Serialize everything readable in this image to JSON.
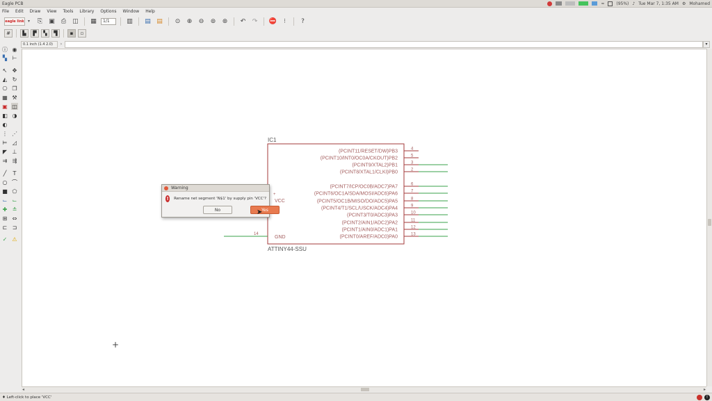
{
  "window": {
    "title": "Eagle PCB"
  },
  "system_tray": {
    "battery": "(95%)",
    "clock": "Tue Mar 7, 1:35 AM",
    "user": "Mohamed"
  },
  "menu": [
    "File",
    "Edit",
    "Draw",
    "View",
    "Tools",
    "Library",
    "Options",
    "Window",
    "Help"
  ],
  "toolbar": {
    "logo_text": "eagle link",
    "sheet_value": "1/1"
  },
  "command_bar": {
    "grid_label": "0.1 inch (1.4 2.0)",
    "command_value": ""
  },
  "schematic": {
    "part_name": "IC1",
    "part_value": "ATTINY44-SSU",
    "net_color": "#39a049",
    "part_color": "#a33a3a",
    "text_color": "#a35c5c",
    "power_pins": [
      {
        "label": "VCC",
        "number": "1",
        "side": "left",
        "connected": false
      },
      {
        "label": "GND",
        "number": "14",
        "side": "left",
        "connected": true
      }
    ],
    "signal_pins": [
      {
        "label": "(PCINT11/RESET/DW)PB3",
        "number": "4",
        "connected": false
      },
      {
        "label": "(PCINT10/INT0/OC0A/CKOUT)PB2",
        "number": "5",
        "connected": false
      },
      {
        "label": "(PCINT9/XTAL2)PB1",
        "number": "3",
        "connected": true
      },
      {
        "label": "(PCINT8/XTAL1/CLKI)PB0",
        "number": "2",
        "connected": true
      },
      {
        "label": "(PCINT7/ICP/OC0B/ADC7)PA7",
        "number": "6",
        "connected": true
      },
      {
        "label": "(PCINT6/OC1A/SDA/MOSI/ADC6)PA6",
        "number": "7",
        "connected": true
      },
      {
        "label": "(PCINT5/OC1B/MISO/DO/ADC5)PA5",
        "number": "8",
        "connected": true
      },
      {
        "label": "(PCINT4/T1/SCL/USCK/ADC4)PA4",
        "number": "9",
        "connected": true
      },
      {
        "label": "(PCINT3/T0/ADC3)PA3",
        "number": "10",
        "connected": true
      },
      {
        "label": "(PCINT2/AIN1/ADC2)PA2",
        "number": "11",
        "connected": true
      },
      {
        "label": "(PCINT1/AIN0/ADC1)PA1",
        "number": "12",
        "connected": true
      },
      {
        "label": "(PCINT0/AREF/ADC0)PA0",
        "number": "13",
        "connected": true
      }
    ],
    "vcc_plus": "+"
  },
  "dialog": {
    "title": "Warning",
    "message": "Rename net segment 'N$1' by supply pin 'VCC'?",
    "no_label": "No",
    "yes_label": "Yes"
  },
  "status": {
    "text": "♦ Left-click to place 'VCC'"
  }
}
